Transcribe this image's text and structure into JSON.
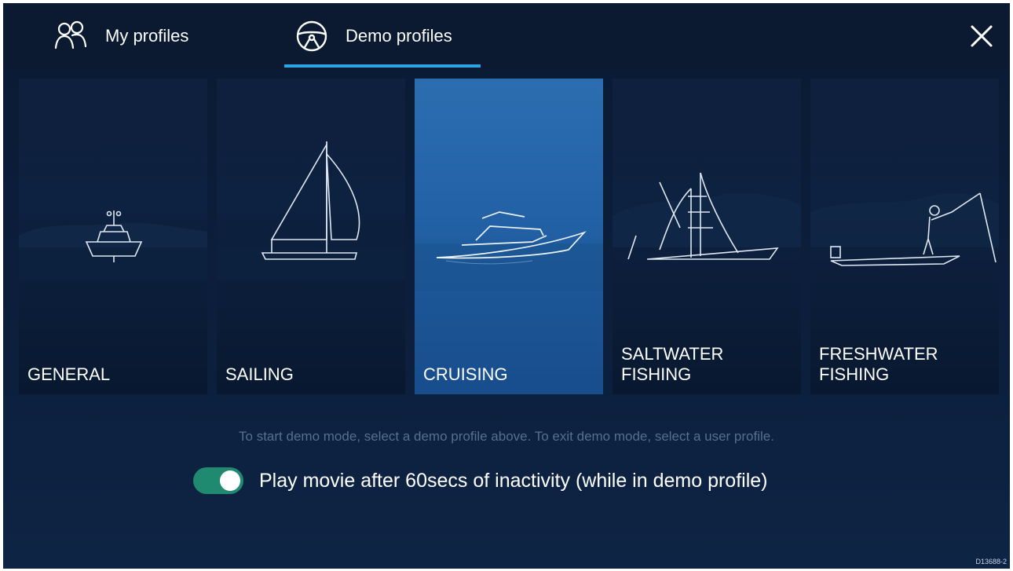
{
  "tabs": {
    "my_profiles": "My profiles",
    "demo_profiles": "Demo profiles",
    "active": "demo_profiles"
  },
  "icons": {
    "my_profiles": "people-icon",
    "demo_profiles": "helm-icon",
    "close": "close-icon"
  },
  "profiles": [
    {
      "label": "GENERAL",
      "selected": false
    },
    {
      "label": "SAILING",
      "selected": false
    },
    {
      "label": "CRUISING",
      "selected": true
    },
    {
      "label": "SALTWATER\nFISHING",
      "selected": false
    },
    {
      "label": "FRESHWATER\nFISHING",
      "selected": false
    }
  ],
  "info_text": "To start demo mode, select a demo profile above. To exit demo mode, select a user profile.",
  "toggle": {
    "label": "Play movie after 60secs of inactivity (while in demo profile)",
    "on": true
  },
  "doc_code": "D13688-2",
  "colors": {
    "background": "#0c1f3d",
    "accent": "#2ea3e6",
    "selected_card": "#2361a6",
    "toggle_on": "#1f8a70"
  }
}
